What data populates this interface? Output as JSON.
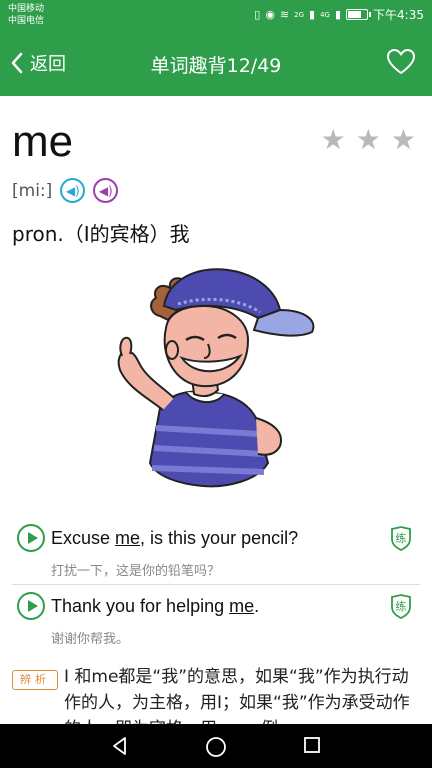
{
  "status_bar": {
    "carrier1": "中国移动",
    "carrier2": "中国电信",
    "net1": "2G",
    "net2": "4G",
    "time": "下午4:35"
  },
  "app_bar": {
    "back_label": "返回",
    "title": "单词趣背12/49"
  },
  "word": {
    "text": "me",
    "phonetic": "[mi:]",
    "definition": "pron.（I的宾格）我",
    "star_count": 3
  },
  "examples": [
    {
      "en_pre": "Excuse ",
      "en_hl": "me",
      "en_post": ", is this your pencil?",
      "zh": "打扰一下，这是你的铅笔吗？",
      "practice": "练"
    },
    {
      "en_pre": "Thank you for helping ",
      "en_hl": "me",
      "en_post": ".",
      "zh": "谢谢你帮我。",
      "practice": "练"
    }
  ],
  "note": {
    "badge": "辨析",
    "text": "I 和me都是“我”的意思，如果“我”作为执行动作的人，为主格，用I；如果“我”作为承受动作的人，即为宾格，用me。例"
  },
  "colors": {
    "brand": "#2e9e4a",
    "uk_speaker": "#27a9d6",
    "us_speaker": "#9b3fb0",
    "badge": "#e08b3c"
  },
  "icons": [
    "back-arrow-icon",
    "heart-icon",
    "star-icon",
    "speaker-icon",
    "play-icon",
    "practice-icon",
    "nav-back-icon",
    "nav-home-icon",
    "nav-recents-icon"
  ]
}
